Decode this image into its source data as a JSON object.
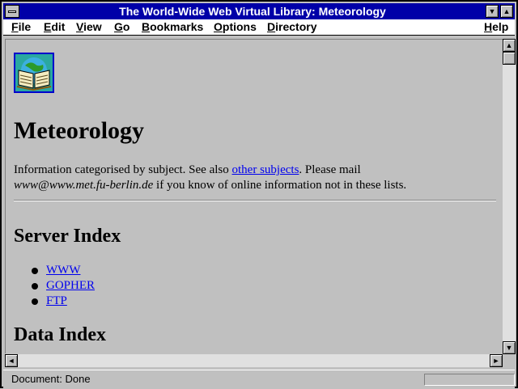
{
  "window": {
    "title": "The World-Wide Web Virtual Library: Meteorology"
  },
  "menubar": {
    "items": [
      {
        "first": "F",
        "rest": "ile"
      },
      {
        "first": "E",
        "rest": "dit"
      },
      {
        "first": "V",
        "rest": "iew"
      },
      {
        "first": "G",
        "rest": "o"
      },
      {
        "first": "B",
        "rest": "ookmarks"
      },
      {
        "first": "O",
        "rest": "ptions"
      },
      {
        "first": "D",
        "rest": "irectory"
      },
      {
        "first": "H",
        "rest": "elp"
      }
    ]
  },
  "page": {
    "heading": "Meteorology",
    "intro_text_1": "Information categorised by subject. See also ",
    "intro_link": "other subjects",
    "intro_text_2": ". Please mail",
    "intro_email": "www@www.met.fu-berlin.de",
    "intro_text_3": " if you know of online information not in these lists.",
    "server_index_heading": "Server Index",
    "server_links": [
      "WWW",
      "GOPHER",
      "FTP"
    ],
    "data_index_heading": "Data Index"
  },
  "status": {
    "text": "Document: Done"
  },
  "colors": {
    "titlebar": "#0000a8",
    "link": "#0000ee",
    "background": "#c0c0c0"
  },
  "icons": {
    "logo": "globe-book-icon",
    "system_menu": "system-menu-icon",
    "minimize": "minimize-arrow-icon",
    "maximize": "maximize-arrow-icon"
  }
}
